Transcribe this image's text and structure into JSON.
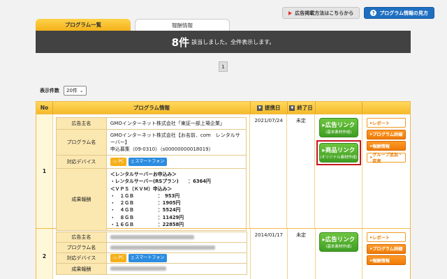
{
  "top_buttons": {
    "ad_method": "広告掲載方法はこちらから",
    "program_info": "プログラム情報の見方"
  },
  "tabs": [
    "プログラム一覧",
    "報酬情報"
  ],
  "banner": {
    "count": "8件",
    "message": "該当しました。全件表示します。"
  },
  "pager": {
    "current": "1"
  },
  "display_count": {
    "label": "表示件数",
    "value": "20件"
  },
  "table": {
    "headers": {
      "no": "No",
      "program_info": "プログラム情報",
      "start_date": "提携日",
      "end_date": "終了日"
    },
    "field_labels": {
      "advertiser": "広告主名",
      "program_name": "プログラム名",
      "devices": "対応デバイス",
      "reward": "成果報酬"
    },
    "device_tags": {
      "pc": "PC",
      "sp": "スマートフォン"
    },
    "rows": [
      {
        "no": "1",
        "advertiser": "GMOインターネット株式会社「東証一部上場企業」",
        "program_line1": "GMOインターネット株式会社【お名前．com　レンタルサーバー】",
        "program_line2": "申込募集（09-0310）（s00000000018019）",
        "reward_text": "＜レンタルサーバーお申込み＞\n・レンタルサーバー(RSプラン)　　：6364円\n＜ＶＰＳ（ＫＶＭ）申込み＞\n・　１ＧＢ　　　　　：　953円\n・　２ＧＢ　　　　　：1905円\n・　４ＧＢ　　　　　：5524円\n・　８ＧＢ　　　　　：11429円\n・１６ＧＢ　　　　　：22858円",
        "start_date": "2021/07/24",
        "end_date": "未定"
      },
      {
        "no": "2",
        "start_date": "2014/01/17",
        "end_date": "未定"
      }
    ],
    "link_buttons": {
      "ad_link": "広告リンク",
      "ad_link_sub": "(基本素材作成)",
      "product_link": "商品リンク",
      "product_link_sub": "(オリジナル素材作成)"
    },
    "action_buttons": {
      "report": "レポート",
      "program_detail": "プログラム詳細",
      "reward_info": "報酬情報",
      "group_add": "グループ追加・変更"
    }
  },
  "colors": {
    "accent": "#f5bb2a",
    "banner": "#424242",
    "green": "#4caf2c",
    "highlight": "#c9151e"
  }
}
